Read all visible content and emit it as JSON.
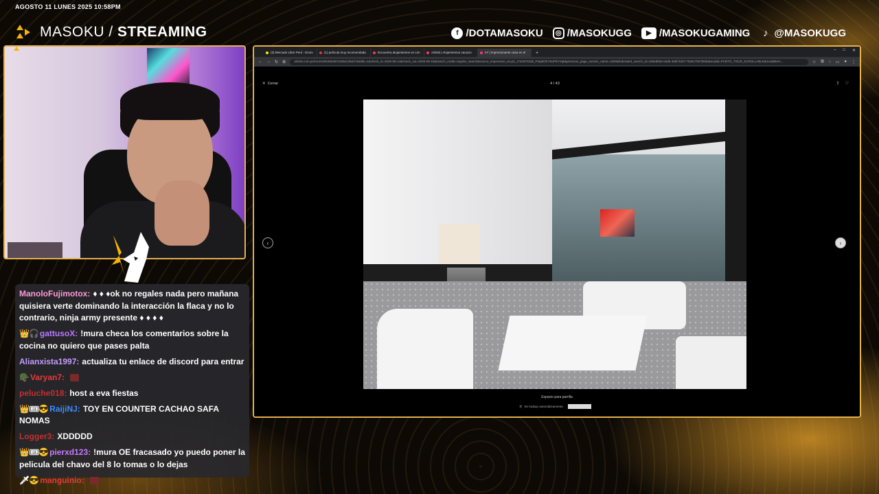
{
  "overlay": {
    "datetime": "AGOSTO 11 LUNES 2025 10:58PM",
    "brand_light": "MASOKU / ",
    "brand_bold": "STREAMING",
    "socials": [
      {
        "icon": "facebook-icon",
        "glyph": "f",
        "label": "/DOTAMASOKU"
      },
      {
        "icon": "instagram-icon",
        "glyph": "◎",
        "label": "/MASOKUGG"
      },
      {
        "icon": "youtube-icon",
        "glyph": "▶",
        "label": "/MASOKUGAMING"
      },
      {
        "icon": "tiktok-icon",
        "glyph": "♪",
        "label": "@MASOKUGG"
      }
    ],
    "accent": "#f5b400",
    "frame_color": "#e6b24a"
  },
  "browser": {
    "tabs": [
      {
        "label": "(3) Mercado Libre Perú - Envío",
        "fav_color": "#ffe600"
      },
      {
        "label": "(1) película muy recomendada",
        "fav_color": "#e33"
      },
      {
        "label": "Encuentra alojamientos en Lim",
        "fav_color": "#ff385c"
      },
      {
        "label": "Airbnb | Alojamientos vacacio",
        "fav_color": "#ff385c"
      },
      {
        "label": "m² | Impresionante casa en el",
        "fav_color": "#ff385c"
      }
    ],
    "new_tab": "+",
    "url": "airbnb.com.pe/rooms/915504674185413642?adults=1&check_in=2025-08-14&check_out=2025-08-15&search_mode=regular_search&source_impression_id=p3_1754970335_P3qI6Oh7SUP5YXqk&previous_page_section_name=1000&federated_search_id=1954db92-e6db-455f-9337-7828c75078606&modal=PHOTO_TOUR_SCROLLABLE&modalItem...",
    "window_controls": [
      "–",
      "□",
      "✕"
    ]
  },
  "viewer": {
    "close_label": "Cerrar",
    "counter": "4 / 43",
    "caption": "Espacio para parrilla",
    "translate_note": "Se tradujo automáticamente."
  },
  "chat": [
    {
      "badges": "",
      "user": "ManoloFujimotox:",
      "color": "#ff9ad8",
      "text": "♦ ♦ ♦ok no regales nada pero mañana quisiera verte dominando la interacción la flaca y no lo contrario, ninja army presente ♦ ♦ ♦ ♦"
    },
    {
      "badges": "👑🎧",
      "user": "gattusoX:",
      "color": "#b77aff",
      "text": "!mura checa los comentarios sobre la cocina no quiero que pases palta"
    },
    {
      "badges": "",
      "user": "Alianxista1997:",
      "color": "#c59cff",
      "text": "actualiza tu enlace de discord para entrar"
    },
    {
      "badges": "🪖",
      "user": "Varyan7:",
      "color": "#e23b3b",
      "text": "",
      "emote": true
    },
    {
      "badges": "",
      "user": "peluche018:",
      "color": "#c43030",
      "text": "host a eva fiestas"
    },
    {
      "badges": "👑🎟😎",
      "user": "RaijiNJ:",
      "color": "#3a8dff",
      "text": "TOY EN COUNTER CACHAO SAFA NOMAS"
    },
    {
      "badges": "",
      "user": "Logger3:",
      "color": "#c43030",
      "text": "XDDDDD"
    },
    {
      "badges": "👑🎟😎",
      "user": "pierxd123:",
      "color": "#c67bff",
      "text": "!mura OE fracasado yo puedo poner la pelicula del chavo del 8 lo tomas o lo dejas"
    },
    {
      "badges": "🗡😎",
      "user": "manguinio:",
      "color": "#e23b3b",
      "text": "",
      "emote": true
    }
  ]
}
